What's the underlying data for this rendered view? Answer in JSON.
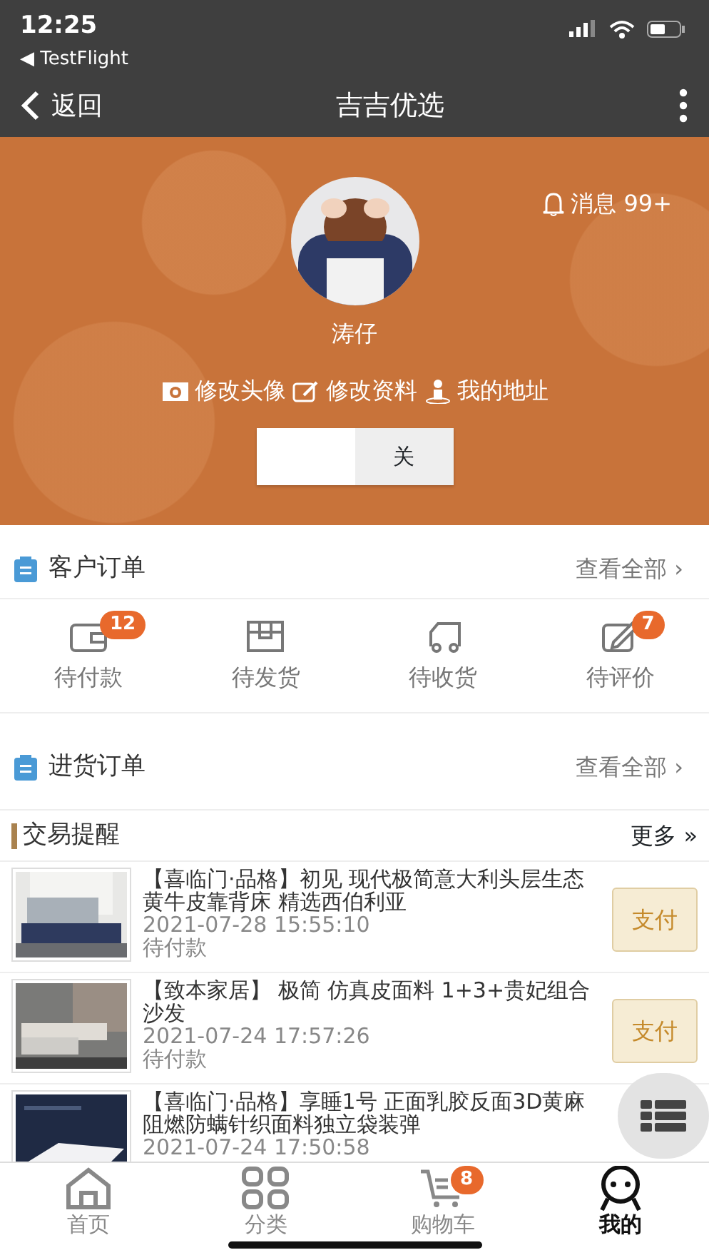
{
  "status_bar": {
    "time": "12:25",
    "back_app": "◀ TestFlight"
  },
  "nav": {
    "back": "返回",
    "title": "吉吉优选"
  },
  "profile": {
    "notice": "消息 99+",
    "name": "涛仔",
    "actions": [
      {
        "kind": "camera",
        "label": "修改头像"
      },
      {
        "kind": "edit",
        "label": "修改资料"
      },
      {
        "kind": "person",
        "label": "我的地址"
      }
    ],
    "toggle": {
      "label": "关",
      "on": false
    }
  },
  "customer_orders": {
    "title": "客户订单",
    "more": "查看全部 ›",
    "statuses": [
      {
        "kind": "wallet",
        "label": "待付款",
        "badge": "12"
      },
      {
        "kind": "box",
        "label": "待发货"
      },
      {
        "kind": "truck",
        "label": "待收货"
      },
      {
        "kind": "review",
        "label": "待评价",
        "badge": "7"
      }
    ]
  },
  "purchase_orders": {
    "title": "进货订单",
    "more": "查看全部 ›"
  },
  "reminders": {
    "title": "交易提醒",
    "more": "更多 »",
    "items": [
      {
        "title": "【喜临门·品格】初见 现代极简意大利头层生态黄牛皮靠背床 精选西伯利亚",
        "time": "2021-07-28 15:55:10",
        "status": "待付款",
        "action": "支付"
      },
      {
        "title": "【致本家居】 极简 仿真皮面料 1+3+贵妃组合沙发",
        "time": "2021-07-24 17:57:26",
        "status": "待付款",
        "action": "支付"
      },
      {
        "title": "【喜临门·品格】享睡1号 正面乳胶反面3D黄麻阻燃防螨针织面料独立袋装弹",
        "time": "2021-07-24 17:50:58"
      }
    ]
  },
  "tab_bar": [
    {
      "kind": "home",
      "label": "首页",
      "selected": false
    },
    {
      "kind": "grid",
      "label": "分类",
      "selected": false
    },
    {
      "kind": "cart",
      "label": "购物车",
      "badge": "8",
      "selected": false
    },
    {
      "kind": "me",
      "label": "我的",
      "selected": true
    }
  ]
}
